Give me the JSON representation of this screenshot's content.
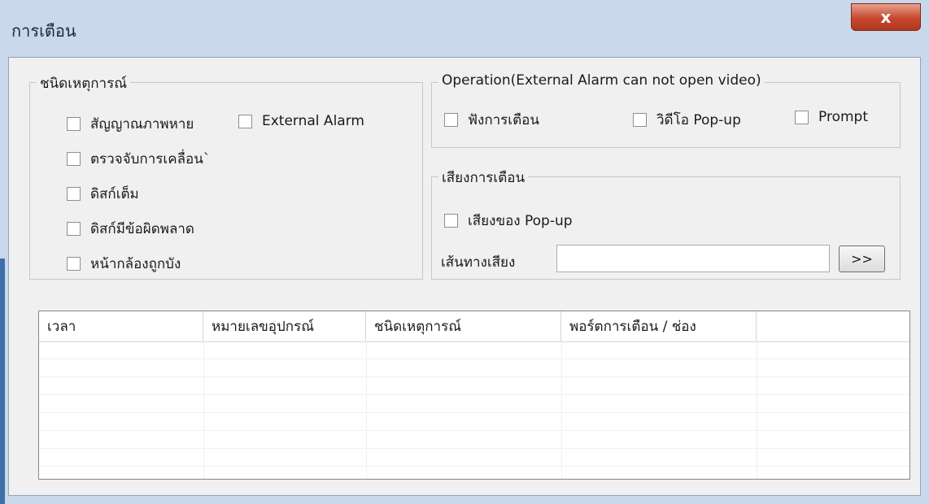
{
  "window": {
    "title": "การเตือน",
    "close_glyph": "x"
  },
  "event_type_group": {
    "legend": "ชนิดเหตุการณ์",
    "checkboxes": [
      {
        "label": "สัญญาณภาพหาย",
        "checked": false
      },
      {
        "label": "External Alarm",
        "checked": false
      },
      {
        "label": "ตรวจจับการเคลื่อน`",
        "checked": false
      },
      {
        "label": "ดิสก์เต็ม",
        "checked": false
      },
      {
        "label": "ดิสก์มีข้อผิดพลาด",
        "checked": false
      },
      {
        "label": "หน้ากล้องถูกบัง",
        "checked": false
      }
    ]
  },
  "operation_group": {
    "legend": "Operation(External Alarm can not open video)",
    "checkboxes": [
      {
        "label": "ฟังการเตือน",
        "checked": false
      },
      {
        "label": "วิดีโอ Pop-up",
        "checked": false
      },
      {
        "label": "Prompt",
        "checked": false
      }
    ]
  },
  "sound_group": {
    "legend": "เสียงการเตือน",
    "popup_sound": {
      "label": "เสียงของ Pop-up",
      "checked": false
    },
    "path_label": "เส้นทางเสียง",
    "path_value": "",
    "browse_label": ">>"
  },
  "alarm_list": {
    "columns": [
      "เวลา",
      "หมายเลขอุปกรณ์",
      "ชนิดเหตุการณ์",
      "พอร์ตการเตือน / ช่อง",
      ""
    ],
    "rows": []
  }
}
